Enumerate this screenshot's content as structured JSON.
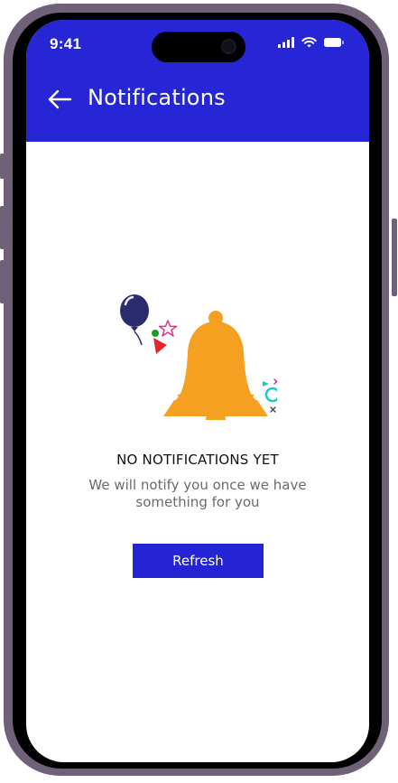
{
  "status_bar": {
    "time": "9:41"
  },
  "header": {
    "title": "Notifications",
    "background_color": "#2626d6"
  },
  "empty_state": {
    "title": "NO NOTIFICATIONS YET",
    "message": "We will notify you once we have something for you",
    "bell_color": "#f5a020",
    "balloon_color": "#2b2c6e"
  },
  "actions": {
    "refresh_label": "Refresh",
    "button_color": "#2424d4"
  },
  "icons": {
    "back": "arrow-left-icon",
    "signal": "signal-bars-icon",
    "wifi": "wifi-icon",
    "battery": "battery-icon"
  }
}
